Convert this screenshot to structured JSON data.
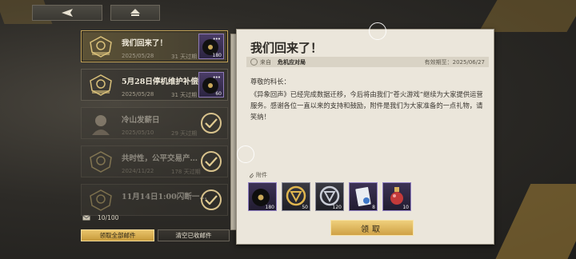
{
  "nav": {
    "back_icon": "back-arrow-icon",
    "home_icon": "home-icon"
  },
  "mails": [
    {
      "title": "我们回来了！",
      "date": "2025/05/28",
      "expiry": "31 天过期",
      "reward_qty": "180",
      "state": "selected"
    },
    {
      "title": "5月28日停机维护补偿",
      "date": "2025/05/28",
      "expiry": "31 天过期",
      "reward_qty": "60",
      "state": "unread"
    },
    {
      "title": "冷山发薪日",
      "date": "2025/05/10",
      "expiry": "29 天过期",
      "state": "read"
    },
    {
      "title": "共时性，公平交易产…",
      "date": "2024/11/22",
      "expiry": "178 天过期",
      "state": "read"
    },
    {
      "title": "11月14日1:00闪断一…",
      "date": "",
      "expiry": "",
      "state": "read"
    }
  ],
  "footer": {
    "count": "10/100",
    "claim_all": "领取全部邮件",
    "clear_read": "清空已收邮件"
  },
  "detail": {
    "title": "我们回来了！",
    "from_label": "来自",
    "sender": "危机应对局",
    "valid_label": "有效期至：2025/06/27",
    "greeting": "尊敬的科长：",
    "body": "《异象回声》已经完成数据迁移，今后将由我们“苍火游戏”继续为大家提供运营服务。感谢各位一直以来的支持和鼓励，附件是我们为大家准备的一点礼物，请笑纳！",
    "attachments_label": "附件",
    "attachments": [
      {
        "icon": "vinyl-record-icon",
        "qty": "180",
        "style": "purple"
      },
      {
        "icon": "gold-emblem-icon",
        "qty": "50",
        "style": "dark"
      },
      {
        "icon": "silver-emblem-icon",
        "qty": "120",
        "style": "dark"
      },
      {
        "icon": "id-card-icon",
        "qty": "8",
        "style": "purple"
      },
      {
        "icon": "potion-bottle-icon",
        "qty": "10",
        "style": "purple"
      }
    ],
    "receive_button": "领取"
  }
}
